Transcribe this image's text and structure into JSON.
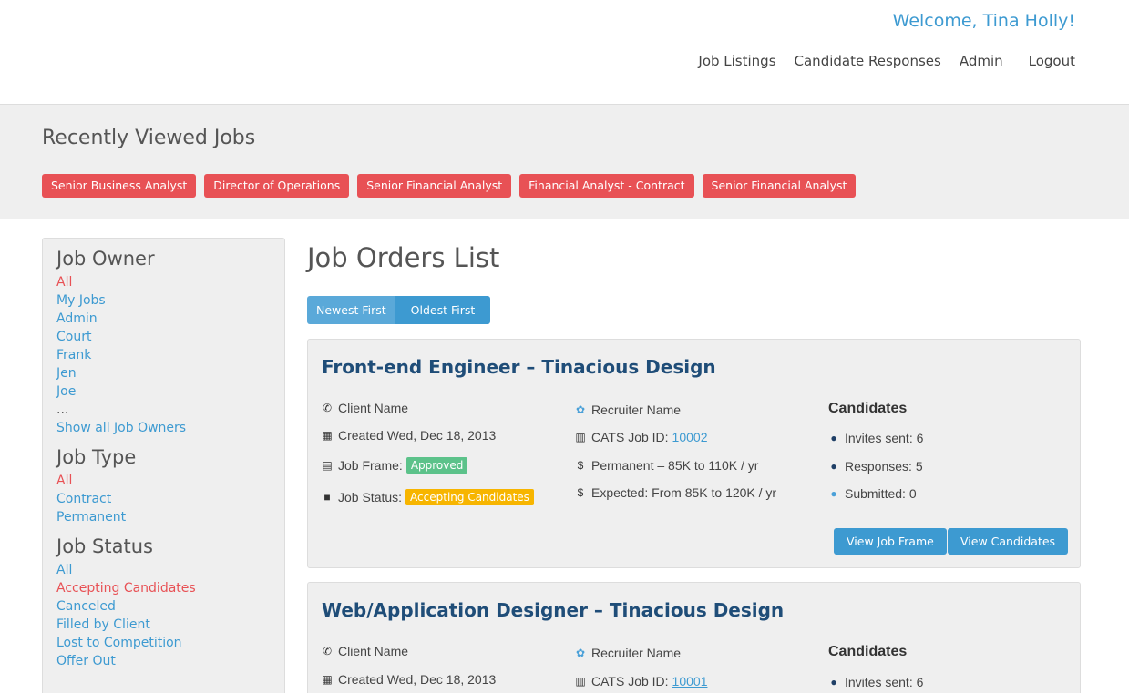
{
  "header": {
    "welcome": "Welcome, Tina Holly!",
    "nav": [
      "Job Listings",
      "Candidate Responses",
      "Admin",
      "Logout"
    ]
  },
  "recent": {
    "title": "Recently Viewed Jobs",
    "tags": [
      "Senior Business Analyst",
      "Director of Operations",
      "Senior Financial Analyst",
      "Financial Analyst - Contract",
      "Senior Financial Analyst"
    ]
  },
  "sidebar": {
    "job_owner": {
      "title": "Job Owner",
      "items": [
        "All",
        "My Jobs",
        "Admin",
        "Court",
        "Frank",
        "Jen",
        "Joe"
      ],
      "dots": "...",
      "show_all": "Show all Job Owners"
    },
    "job_type": {
      "title": "Job Type",
      "items": [
        "All",
        "Contract",
        "Permanent"
      ]
    },
    "job_status": {
      "title": "Job Status",
      "items": [
        "All",
        "Accepting Candidates",
        "Canceled",
        "Filled by Client",
        "Lost to Competition",
        "Offer Out"
      ]
    }
  },
  "main": {
    "title": "Job Orders List",
    "sort": {
      "newest": "Newest First",
      "oldest": "Oldest First"
    }
  },
  "jobs": [
    {
      "title": "Front-end Engineer – Tinacious Design",
      "client": "Client Name",
      "created": "Created Wed, Dec 18, 2013",
      "frame_label": "Job Frame:",
      "frame_status": "Approved",
      "status_label": "Job Status:",
      "status": "Accepting Candidates",
      "recruiter": "Recruiter Name",
      "cats_label": "CATS Job ID:",
      "cats_id": "10002",
      "salary": "Permanent – 85K to 110K / yr",
      "expected": "Expected: From 85K to 120K / yr",
      "candidates_title": "Candidates",
      "invites": "Invites sent: 6",
      "responses": "Responses: 5",
      "submitted": "Submitted: 0",
      "btn_frame": "View Job Frame",
      "btn_candidates": "View Candidates"
    },
    {
      "title": "Web/Application Designer – Tinacious Design",
      "client": "Client Name",
      "created": "Created Wed, Dec 18, 2013",
      "recruiter": "Recruiter Name",
      "cats_label": "CATS Job ID:",
      "cats_id": "10001",
      "candidates_title": "Candidates",
      "invites": "Invites sent: 6"
    }
  ],
  "colors": {
    "accent": "#3d9ad1",
    "tag": "#e85155",
    "heading": "#1f4d78"
  }
}
